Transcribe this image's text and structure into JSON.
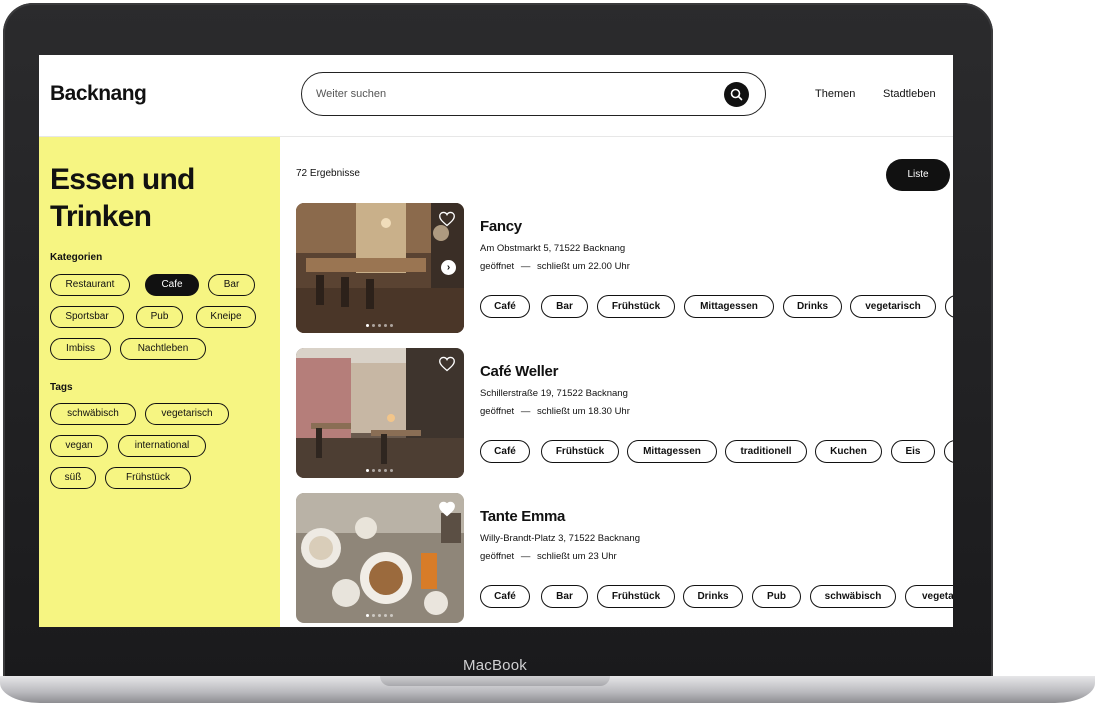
{
  "device": {
    "label": "MacBook"
  },
  "header": {
    "logo": "Backnang",
    "search_placeholder": "Weiter suchen",
    "nav": [
      "Themen",
      "Stadtleben"
    ]
  },
  "sidebar": {
    "title": "Essen und Trinken",
    "categories_label": "Kategorien",
    "categories": [
      {
        "label": "Restaurant",
        "active": false
      },
      {
        "label": "Cafe",
        "active": true
      },
      {
        "label": "Bar",
        "active": false
      },
      {
        "label": "Sportsbar",
        "active": false
      },
      {
        "label": "Pub",
        "active": false
      },
      {
        "label": "Kneipe",
        "active": false
      },
      {
        "label": "Imbiss",
        "active": false
      },
      {
        "label": "Nachtleben",
        "active": false
      }
    ],
    "tags_label": "Tags",
    "tags": [
      "schwäbisch",
      "vegetarisch",
      "vegan",
      "international",
      "süß",
      "Frühstück"
    ]
  },
  "main": {
    "results_count": "72 Ergebnisse",
    "view_button": "Liste",
    "results": [
      {
        "name": "Fancy",
        "address": "Am Obstmarkt 5, 71522 Backnang",
        "status": "geöffnet",
        "separator": "—",
        "hours": "schließt um 22.00 Uhr",
        "tags": [
          "Café",
          "Bar",
          "Frühstück",
          "Mittagessen",
          "Drinks",
          "vegetarisch",
          ""
        ],
        "favorite": false
      },
      {
        "name": "Café Weller",
        "address": "Schillerstraße 19, 71522 Backnang",
        "status": "geöffnet",
        "separator": "—",
        "hours": "schließt um 18.30 Uhr",
        "tags": [
          "Café",
          "Frühstück",
          "Mittagessen",
          "traditionell",
          "Kuchen",
          "Eis",
          ""
        ],
        "favorite": false
      },
      {
        "name": "Tante Emma",
        "address": "Willy-Brandt-Platz 3, 71522 Backnang",
        "status": "geöffnet",
        "separator": "—",
        "hours": "schließt um 23 Uhr",
        "tags": [
          "Café",
          "Bar",
          "Frühstück",
          "Drinks",
          "Pub",
          "schwäbisch",
          "vegeta"
        ],
        "favorite": true
      }
    ]
  }
}
